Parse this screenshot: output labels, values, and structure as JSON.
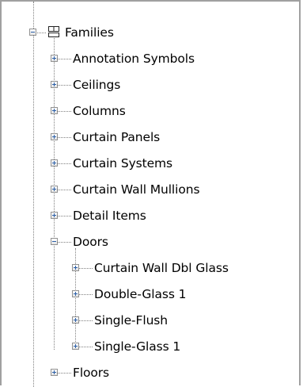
{
  "tree": {
    "root": {
      "label": "Families",
      "icon": "families-icon",
      "expanded": true
    },
    "level1": [
      {
        "label": "Annotation Symbols",
        "expanded": false
      },
      {
        "label": "Ceilings",
        "expanded": false
      },
      {
        "label": "Columns",
        "expanded": false
      },
      {
        "label": "Curtain Panels",
        "expanded": false
      },
      {
        "label": "Curtain Systems",
        "expanded": false
      },
      {
        "label": "Curtain Wall Mullions",
        "expanded": false
      },
      {
        "label": "Detail Items",
        "expanded": false
      },
      {
        "label": "Doors",
        "expanded": true
      }
    ],
    "doors_children": [
      {
        "label": "Curtain Wall Dbl Glass",
        "expanded": false
      },
      {
        "label": "Double-Glass 1",
        "expanded": false
      },
      {
        "label": "Single-Flush",
        "expanded": false
      },
      {
        "label": "Single-Glass 1",
        "expanded": false
      }
    ],
    "after_doors": [
      {
        "label": "Floors",
        "expanded": false
      }
    ]
  },
  "colors": {
    "expander_glyph": "#2b5fa8",
    "connector": "#808080",
    "frame_border": "#a0a0a0"
  }
}
